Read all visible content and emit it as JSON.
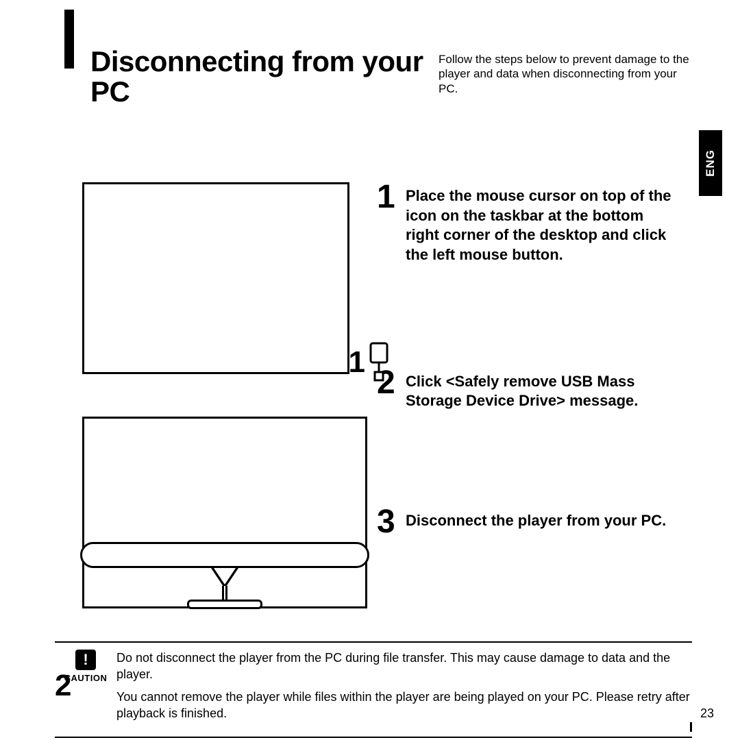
{
  "header": {
    "title": "Disconnecting from your PC",
    "subtitle": "Follow the steps below to prevent damage to the player and data when disconnecting from your PC."
  },
  "lang_tab": "ENG",
  "figure_callouts": {
    "top": "1",
    "bottom": "2"
  },
  "steps": [
    {
      "num": "1",
      "text": "Place the mouse cursor on top of the icon on the taskbar at the bottom right corner of the desktop and click the left mouse button."
    },
    {
      "num": "2",
      "text": "Click <Safely remove USB Mass Storage Device Drive> message."
    },
    {
      "num": "3",
      "text": "Disconnect the player from your PC."
    }
  ],
  "caution": {
    "icon_glyph": "!",
    "label": "CAUTION",
    "lines": [
      "Do not disconnect the player from the PC during file transfer. This may cause damage to data and the player.",
      "You cannot remove the player while files within the player are being played on your PC. Please retry after playback is finished."
    ]
  },
  "page_number": "23"
}
